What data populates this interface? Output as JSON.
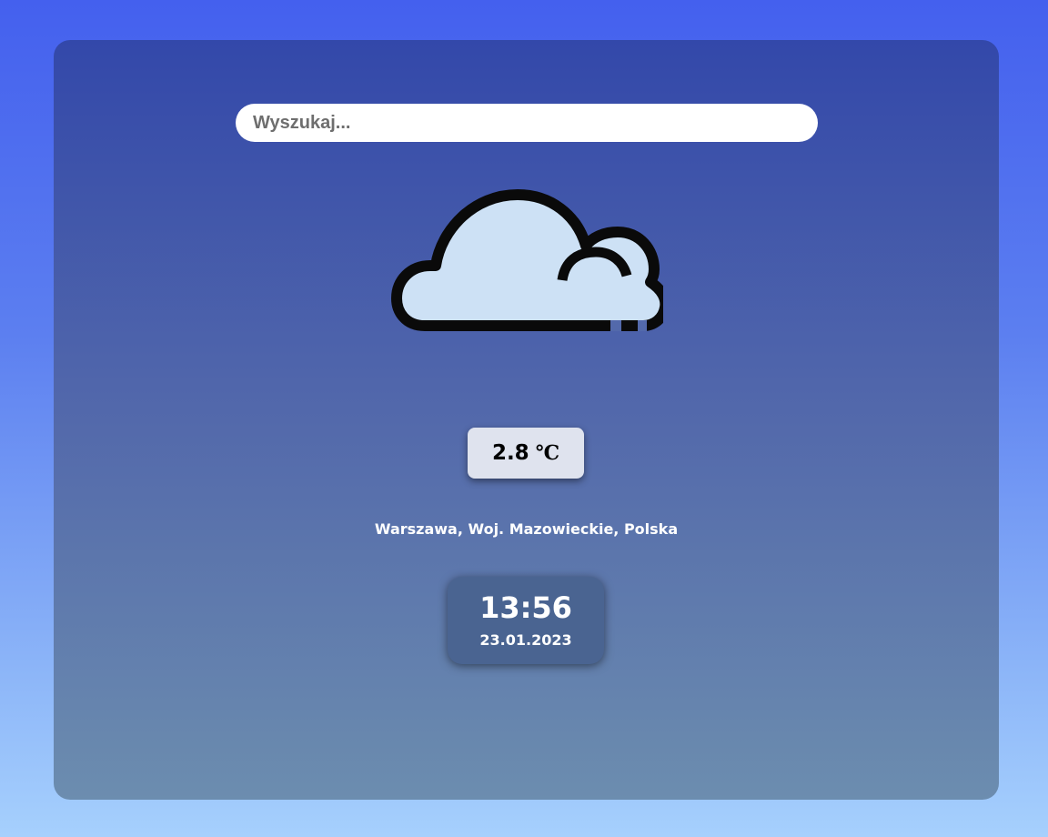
{
  "search": {
    "placeholder": "Wyszukaj...",
    "value": ""
  },
  "weather": {
    "icon": "cloudy-icon",
    "temperature_value": "2.8",
    "temperature_unit": "℃",
    "location": "Warszawa, Woj. Mazowieckie, Polska"
  },
  "clock": {
    "time": "13:56",
    "date": "23.01.2023"
  },
  "colors": {
    "background_top": "#4460ee",
    "background_bottom": "#a6d0fd",
    "card_top": "#3348aa",
    "card_bottom": "#6c8daf",
    "cloud_fill": "#cde1f5",
    "cloud_stroke": "#0a0a0a",
    "temp_box": "#dfe3ee",
    "clock_box": "#4a6491"
  }
}
